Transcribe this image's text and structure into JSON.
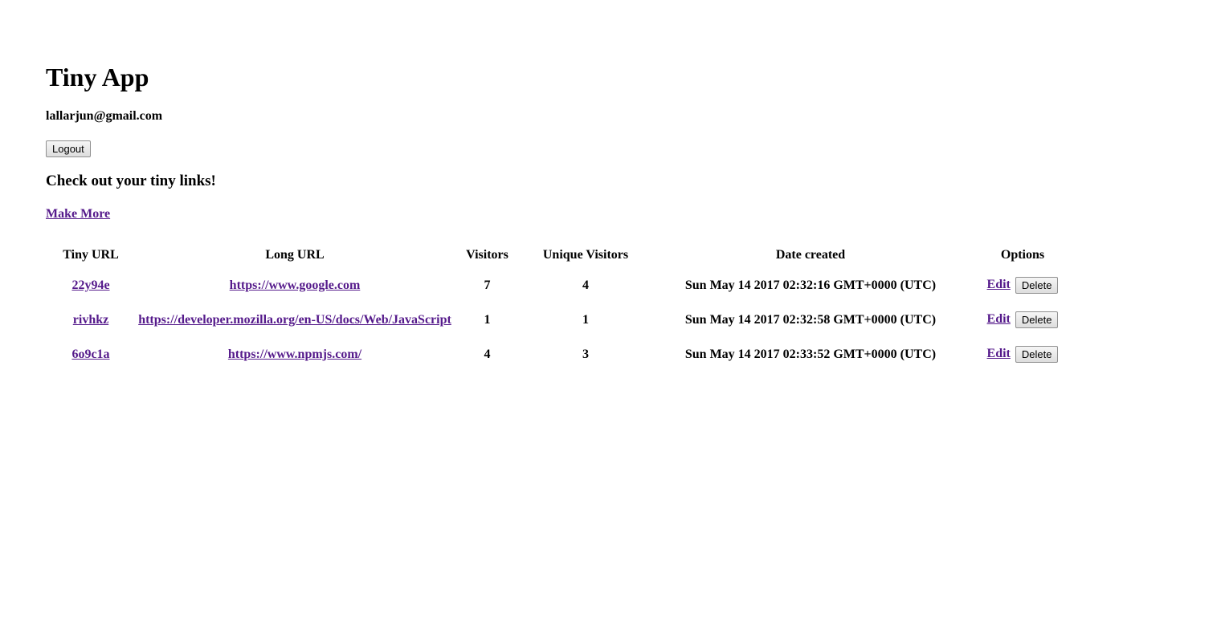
{
  "app": {
    "title": "Tiny App",
    "user_email": "lallarjun@gmail.com",
    "logout_label": "Logout",
    "subtitle": "Check out your tiny links!",
    "make_more_label": "Make More"
  },
  "colors": {
    "link": "#551a8b",
    "text": "#000000",
    "background": "#ffffff"
  },
  "table": {
    "headers": [
      "Tiny URL",
      "Long URL",
      "Visitors",
      "Unique Visitors",
      "Date created",
      "Options"
    ],
    "rows": [
      {
        "tiny_url": "22y94e",
        "long_url": "https://www.google.com",
        "visitors": "7",
        "unique_visitors": "4",
        "date_created": "Sun May 14 2017 02:32:16 GMT+0000 (UTC)",
        "edit_label": "Edit",
        "delete_label": "Delete"
      },
      {
        "tiny_url": "rivhkz",
        "long_url": "https://developer.mozilla.org/en-US/docs/Web/JavaScript",
        "visitors": "1",
        "unique_visitors": "1",
        "date_created": "Sun May 14 2017 02:32:58 GMT+0000 (UTC)",
        "edit_label": "Edit",
        "delete_label": "Delete"
      },
      {
        "tiny_url": "6o9c1a",
        "long_url": "https://www.npmjs.com/",
        "visitors": "4",
        "unique_visitors": "3",
        "date_created": "Sun May 14 2017 02:33:52 GMT+0000 (UTC)",
        "edit_label": "Edit",
        "delete_label": "Delete"
      }
    ]
  }
}
